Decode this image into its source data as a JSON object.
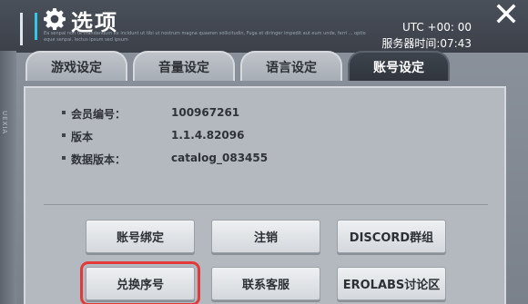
{
  "header": {
    "title": "选项",
    "subtitle": "Ea senpai non te mandandum ex incidunt ut tibi ut nostrum magna quaeren sollicitudin, Fuga et diringer impedit aut eum unde, ferri ... optio eque senpai, lectus ipsum sed ipsum",
    "utc": "UTC +00: 00",
    "server_time": "服务器时间:07:43",
    "left_strip_text": "UEXIA"
  },
  "tabs": [
    {
      "label": "游戏设定",
      "active": false
    },
    {
      "label": "音量设定",
      "active": false
    },
    {
      "label": "语言设定",
      "active": false
    },
    {
      "label": "账号设定",
      "active": true
    }
  ],
  "info": [
    {
      "label": "会员编号：",
      "value": "100967261"
    },
    {
      "label": "版本",
      "value": "1.1.4.82096"
    },
    {
      "label": "数据版本：",
      "value": "catalog_083455"
    }
  ],
  "buttons": {
    "bind_account": "账号绑定",
    "logout": "注销",
    "discord": "DISCORD群组",
    "redeem_code": "兑换序号",
    "contact_support": "联系客服",
    "erolabs_forum": "EROLABS讨论区"
  },
  "colors": {
    "accent": "#33c6e6",
    "highlight": "#e23a3a",
    "active_tab": "#31363e"
  }
}
